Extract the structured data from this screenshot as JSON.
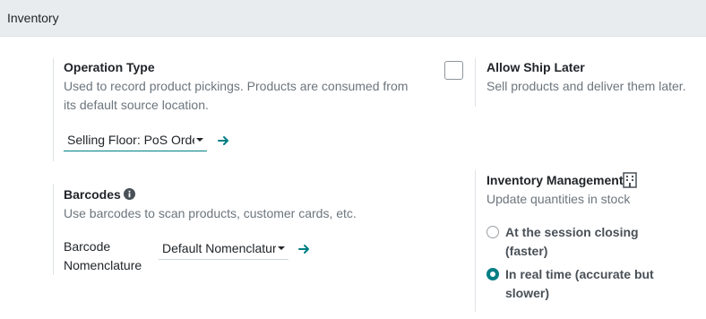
{
  "section": {
    "title": "Inventory"
  },
  "operation_type": {
    "title": "Operation Type",
    "description": "Used to record product pickings. Products are consumed from its default source location.",
    "select_value": "Selling Floor: PoS Orde"
  },
  "allow_ship_later": {
    "title": "Allow Ship Later",
    "description": "Sell products and deliver them later.",
    "checked": false
  },
  "barcodes": {
    "title": "Barcodes",
    "description": "Use barcodes to scan products, customer cards, etc.",
    "field_label": "Barcode Nomenclature",
    "select_value": "Default Nomenclatur"
  },
  "inventory_management": {
    "title": "Inventory Management",
    "description": "Update quantities in stock",
    "options": [
      {
        "label": "At the session closing (faster)",
        "checked": false
      },
      {
        "label": "In real time (accurate but slower)",
        "checked": true
      }
    ]
  },
  "colors": {
    "accent": "#017e84",
    "muted_text": "#6c757d",
    "header_bg": "#e9ecef"
  },
  "icons": {
    "arrow": "arrow-right-icon",
    "info": "info-circle-icon",
    "building": "building-icon"
  }
}
